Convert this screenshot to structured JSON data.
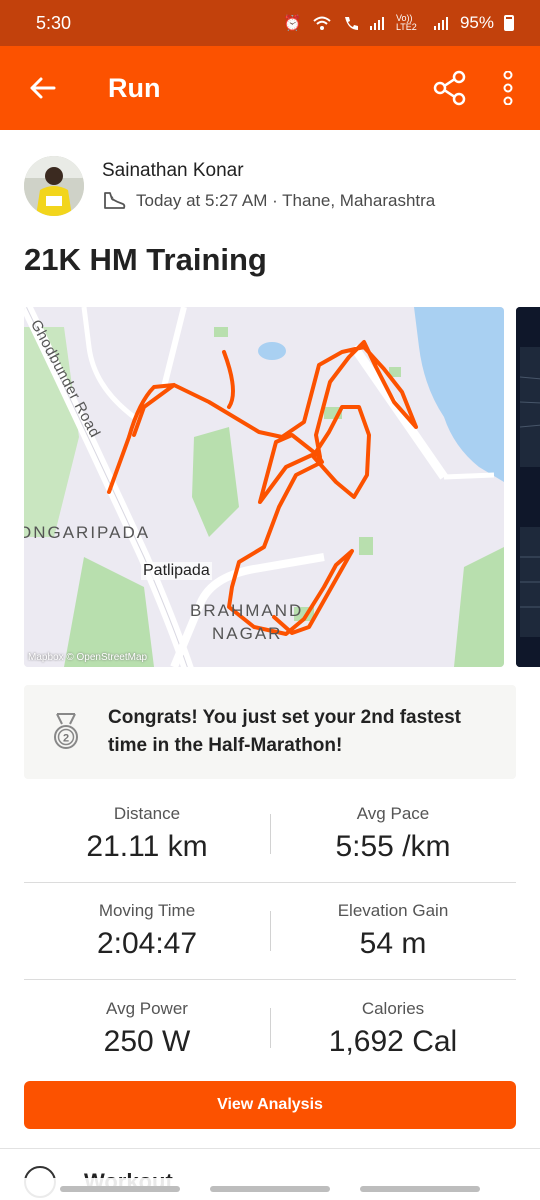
{
  "status_bar": {
    "time": "5:30",
    "network": "Vo)) LTE2",
    "battery": "95%"
  },
  "app_bar": {
    "title": "Run",
    "back_icon": "arrow-left-icon",
    "share_icon": "share-icon",
    "more_icon": "more-vertical-icon"
  },
  "athlete": {
    "name": "Sainathan Konar",
    "meta": "Today at 5:27 AM · Thane, Maharashtra",
    "activity_icon": "shoe-icon"
  },
  "activity": {
    "title": "21K HM Training"
  },
  "map": {
    "labels": {
      "road": "Ghodbunder Road",
      "area1": "ONGARIPADA",
      "area2": "Patlipada",
      "area3_line1": "BRAHMAND",
      "area3_line2": "NAGAR"
    },
    "credit": "Mapbox © OpenStreetMap",
    "route_color": "#fc5200"
  },
  "achievement": {
    "text": "Congrats! You just set your 2nd fastest time in the Half-Marathon!",
    "icon": "medal-icon",
    "rank": "2"
  },
  "stats": [
    [
      {
        "label": "Distance",
        "value": "21.11 km"
      },
      {
        "label": "Avg Pace",
        "value": "5:55 /km"
      }
    ],
    [
      {
        "label": "Moving Time",
        "value": "2:04:47"
      },
      {
        "label": "Elevation Gain",
        "value": "54 m"
      }
    ],
    [
      {
        "label": "Avg Power",
        "value": "250 W"
      },
      {
        "label": "Calories",
        "value": "1,692 Cal"
      }
    ]
  ],
  "actions": {
    "view_analysis": "View Analysis"
  },
  "next_section": {
    "label": "Workout"
  },
  "colors": {
    "brand": "#fc5200",
    "status_bar": "#c2410c"
  }
}
